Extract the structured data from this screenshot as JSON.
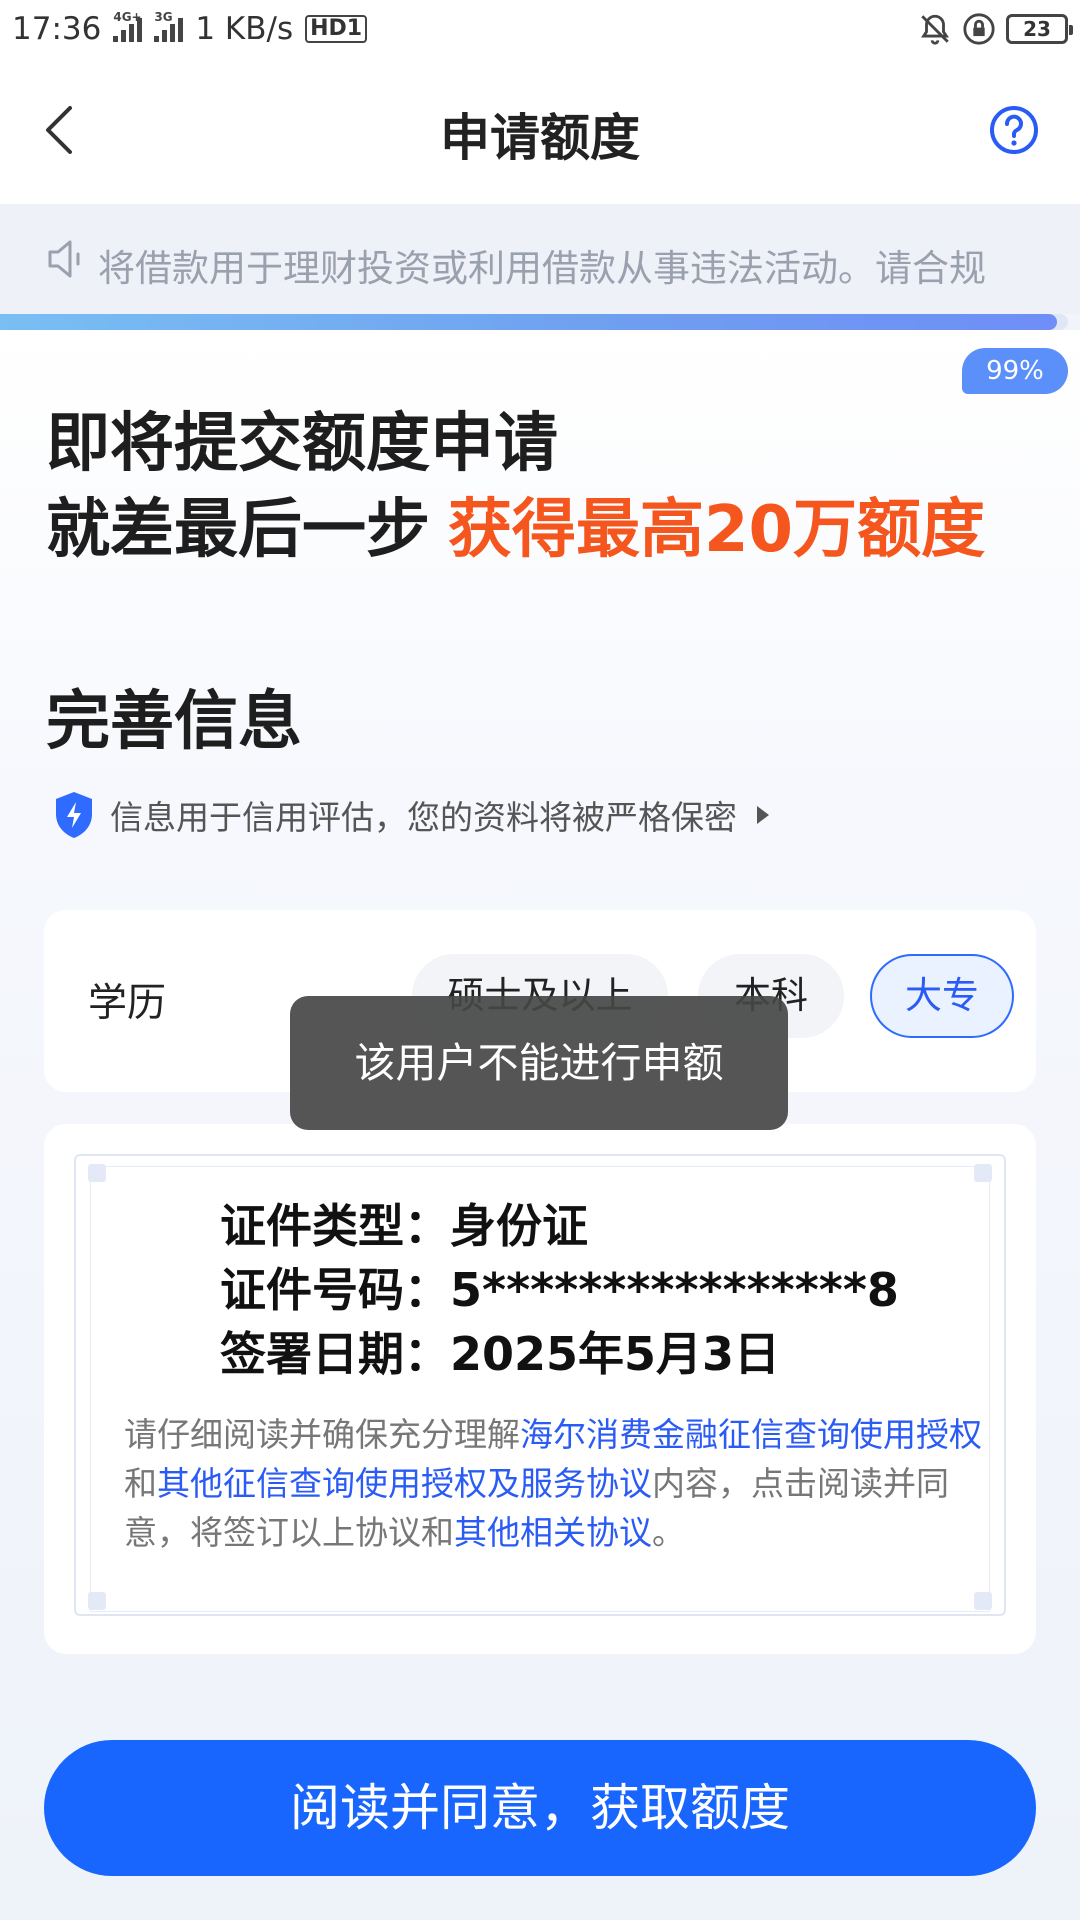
{
  "status_bar": {
    "time": "17:36",
    "network_1": "4G+",
    "network_2": "3G",
    "speed": "1 KB/s",
    "hd": "HD1",
    "battery": "23",
    "icons": [
      "bell-mute-icon",
      "rotation-lock-icon",
      "battery-icon"
    ]
  },
  "nav": {
    "title": "申请额度",
    "back_icon": "chevron-left-icon",
    "help_icon": "question-circle-icon"
  },
  "notice": {
    "icon": "speaker-icon",
    "text": "将借款用于理财投资或利用借款从事违法活动。请合规"
  },
  "progress": {
    "percent": 99,
    "label": "99%"
  },
  "hero": {
    "line1": "即将提交额度申请",
    "line2_prefix": "就差最后一步",
    "line2_highlight": "获得最高20万额度"
  },
  "section": {
    "title": "完善信息",
    "privacy_icon": "shield-lightning-icon",
    "privacy_text": "信息用于信用评估，您的资料将被严格保密"
  },
  "education": {
    "label": "学历",
    "options": [
      "硕士及以上",
      "本科",
      "大专",
      ""
    ],
    "selected": "大专"
  },
  "toast": {
    "text": "该用户不能进行申额"
  },
  "certificate": {
    "id_type": "证件类型：身份证",
    "id_number": "证件号码：5****************8",
    "sign_date": "签署日期：2025年5月3日"
  },
  "consent": {
    "part1": "请仔细阅读并确保充分理解",
    "link1": "海尔消费金融征信查询使用授权",
    "part2": "和",
    "link2": "其他征信查询使用授权及服务协议",
    "part3": "内容，点击阅读并同意，将签订以上协议和",
    "link3": "其他相关协议",
    "part4": "。"
  },
  "cta": {
    "label": "阅读并同意，获取额度"
  },
  "colors": {
    "primary": "#1966ff",
    "highlight": "#f4561e",
    "progress_badge": "#5b8ff9"
  }
}
